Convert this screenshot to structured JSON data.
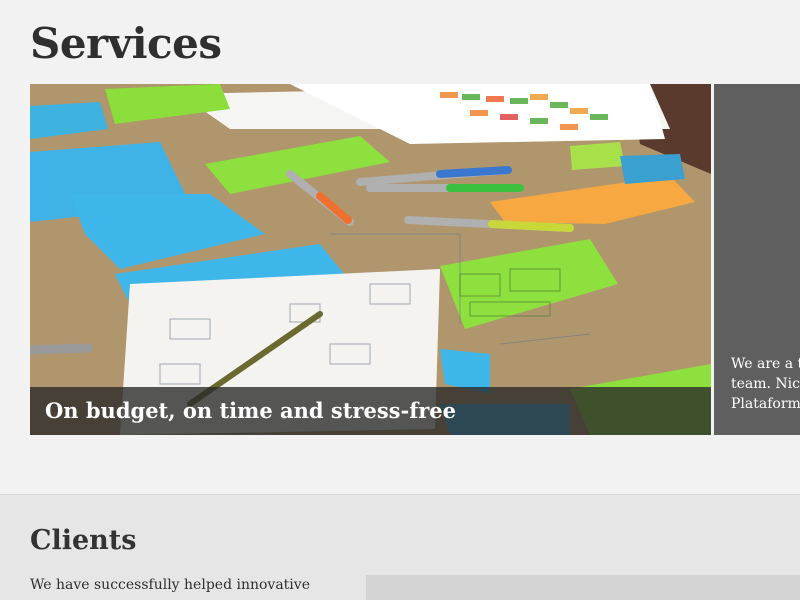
{
  "services": {
    "title": "Services",
    "slides": [
      {
        "caption": "On budget, on time and stress-free"
      },
      {
        "text_lines": [
          "We are a t",
          "team. Nice",
          "Plataform"
        ]
      }
    ]
  },
  "clients": {
    "title": "Clients",
    "description": "We have successfully helped innovative"
  }
}
